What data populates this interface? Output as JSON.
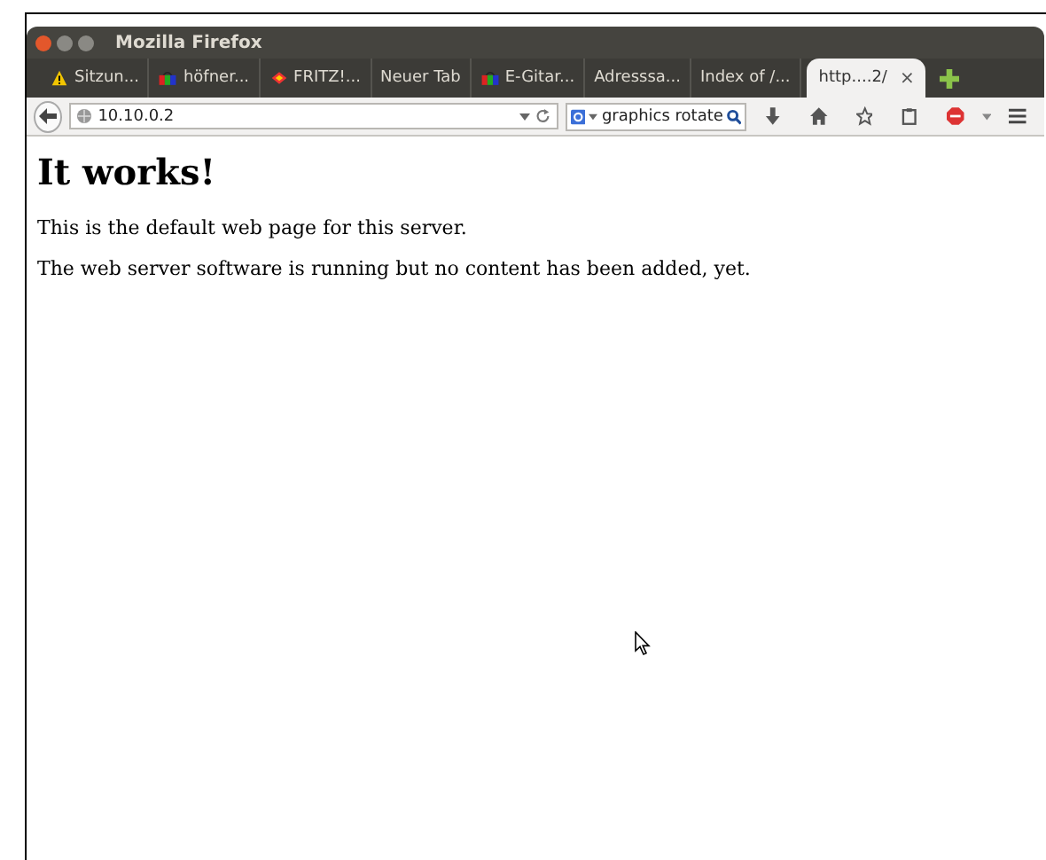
{
  "window": {
    "title": "Mozilla Firefox"
  },
  "tabs": [
    {
      "label": "Sitzun...",
      "kind": "warning",
      "selected": false
    },
    {
      "label": "höfner...",
      "kind": "shop",
      "selected": false
    },
    {
      "label": "FRITZ!...",
      "kind": "diamond",
      "selected": false
    },
    {
      "label": "Neuer Tab",
      "kind": "plain",
      "selected": false
    },
    {
      "label": "E-Gitar...",
      "kind": "shop",
      "selected": false
    },
    {
      "label": "Adresssa...",
      "kind": "plain",
      "selected": false
    },
    {
      "label": "Index of /...",
      "kind": "plain",
      "selected": false
    },
    {
      "label": "http....2/",
      "kind": "plain",
      "selected": true,
      "close": "×"
    }
  ],
  "address_bar": {
    "value": "10.10.0.2"
  },
  "search": {
    "value": "graphics rotate"
  },
  "page": {
    "heading": "It works!",
    "paragraphs": [
      "This is the default web page for this server.",
      "The web server software is running but no content has been added, yet."
    ]
  }
}
